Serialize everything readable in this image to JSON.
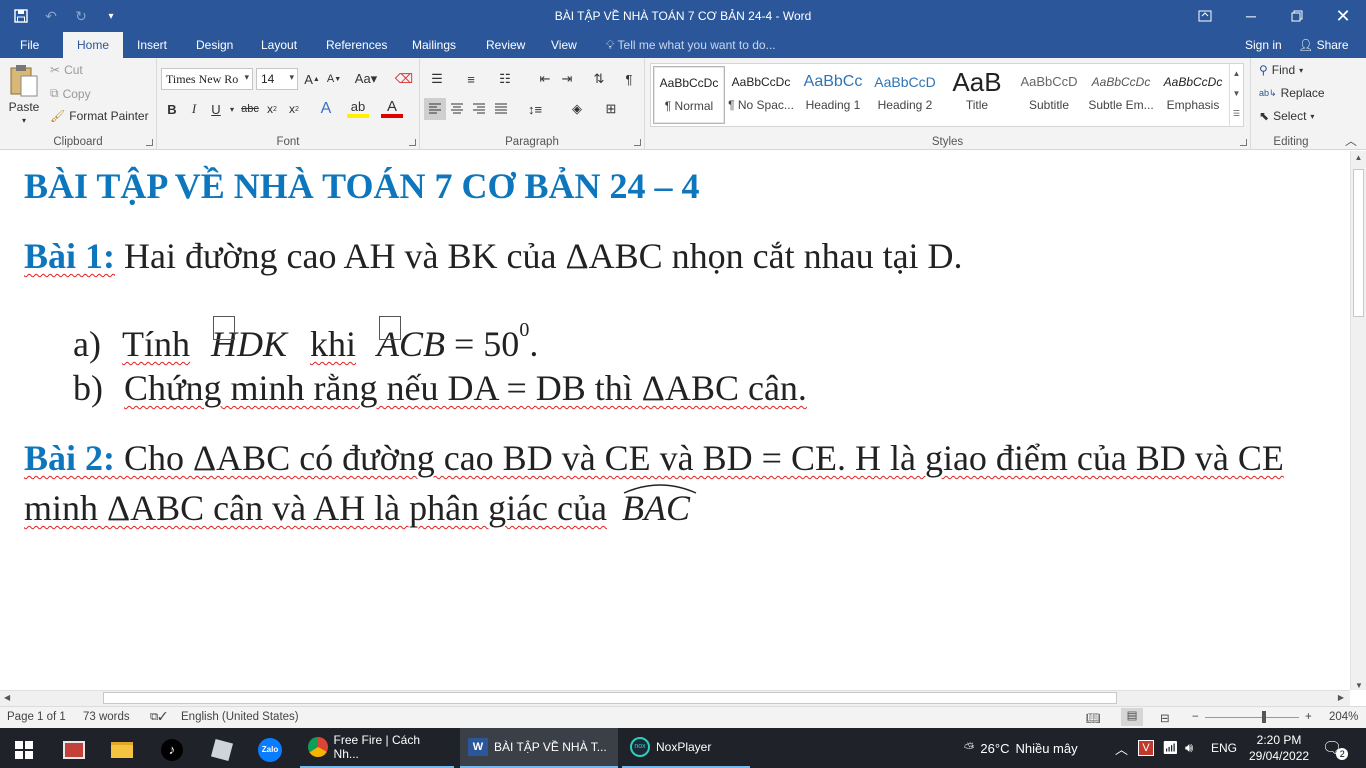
{
  "window": {
    "title": "BÀI TẬP VỀ NHÀ TOÁN 7 CƠ BẢN 24-4 - Word"
  },
  "tabs": [
    {
      "label": "File"
    },
    {
      "label": "Home"
    },
    {
      "label": "Insert"
    },
    {
      "label": "Design"
    },
    {
      "label": "Layout"
    },
    {
      "label": "References"
    },
    {
      "label": "Mailings"
    },
    {
      "label": "Review"
    },
    {
      "label": "View"
    }
  ],
  "tellme": "Tell me what you want to do...",
  "signin": "Sign in",
  "share": "Share",
  "clipboard": {
    "paste": "Paste",
    "cut": "Cut",
    "copy": "Copy",
    "format_painter": "Format Painter",
    "label": "Clipboard"
  },
  "font": {
    "family": "Times New Ro",
    "size": "14",
    "label": "Font"
  },
  "paragraph": {
    "label": "Paragraph"
  },
  "styles": {
    "label": "Styles",
    "items": [
      {
        "preview": "AaBbCcDc",
        "name": "¶ Normal"
      },
      {
        "preview": "AaBbCcDc",
        "name": "¶ No Spac..."
      },
      {
        "preview": "AaBbCc",
        "name": "Heading 1"
      },
      {
        "preview": "AaBbCcD",
        "name": "Heading 2"
      },
      {
        "preview": "AaB",
        "name": "Title"
      },
      {
        "preview": "AaBbCcD",
        "name": "Subtitle"
      },
      {
        "preview": "AaBbCcDc",
        "name": "Subtle Em..."
      },
      {
        "preview": "AaBbCcDc",
        "name": "Emphasis"
      }
    ]
  },
  "editing": {
    "find": "Find",
    "replace": "Replace",
    "select": "Select",
    "label": "Editing"
  },
  "document": {
    "heading": "BÀI TẬP VỀ NHÀ TOÁN 7 CƠ BẢN 24 – 4",
    "bai1_label": "Bài 1:",
    "bai1_text": " Hai đường cao AH và BK của ΔABC nhọn cắt nhau tại D.",
    "a_label": "a)",
    "a_text": "Tính",
    "a_angle1": "HDK",
    "a_khi": "khi",
    "a_angle2": "ACB",
    "a_value": "= 50",
    "a_sup": "0",
    "a_end": ".",
    "b_label": "b)",
    "b_text": "Chứng minh rằng nếu DA = DB thì ΔABC cân.",
    "bai2_label": "Bài 2:",
    "bai2_text": " Cho ΔABC có đường cao BD và CE và BD = CE. H là giao điểm của BD và CE",
    "bai2_line2": "minh ΔABC  cân và AH là phân giác của",
    "bai2_angle": "BAC"
  },
  "status": {
    "page": "Page 1 of 1",
    "words": "73 words",
    "language": "English (United States)",
    "zoom": "204%"
  },
  "taskbar": {
    "apps": [
      {
        "label": "Free Fire | Cách Nh..."
      },
      {
        "label": "BÀI TẬP VỀ NHÀ T..."
      },
      {
        "label": "NoxPlayer"
      }
    ],
    "weather_temp": "26°C",
    "weather_desc": "Nhiều mây",
    "lang": "ENG",
    "time": "2:20 PM",
    "date": "29/04/2022",
    "notifications": "2"
  }
}
